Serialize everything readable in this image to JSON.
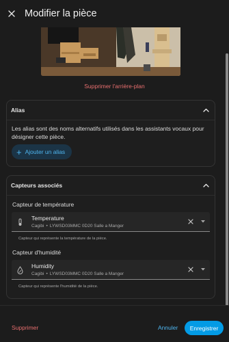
{
  "header": {
    "title": "Modifier la pièce",
    "close_icon": "close-icon"
  },
  "background": {
    "remove_label": "Supprimer l'arrière-plan"
  },
  "alias": {
    "title": "Alias",
    "description": "Les alias sont des noms alternatifs utilisés dans les assistants vocaux pour désigner cette pièce.",
    "add_label": "Ajouter un alias"
  },
  "sensors": {
    "title": "Capteurs associés",
    "temperature": {
      "label": "Capteur de température",
      "name": "Temperature",
      "area": "Cagibi",
      "device": "LYWSD03MMC 0D20 Salle a Manger",
      "helper": "Capteur qui représente la température de la pièce.",
      "icon": "thermometer-icon"
    },
    "humidity": {
      "label": "Capteur d'humidité",
      "name": "Humidity",
      "area": "Cagibi",
      "device": "LYWSD03MMC 0D20 Salle a Manger",
      "helper": "Capteur qui représente l'humidité de la pièce.",
      "icon": "water-drop-icon"
    },
    "separator": "•"
  },
  "footer": {
    "delete_label": "Supprimer",
    "cancel_label": "Annuler",
    "save_label": "Enregistrer"
  },
  "colors": {
    "accent": "#039be5",
    "danger": "#e86f6f",
    "background": "#1c1c1c"
  }
}
